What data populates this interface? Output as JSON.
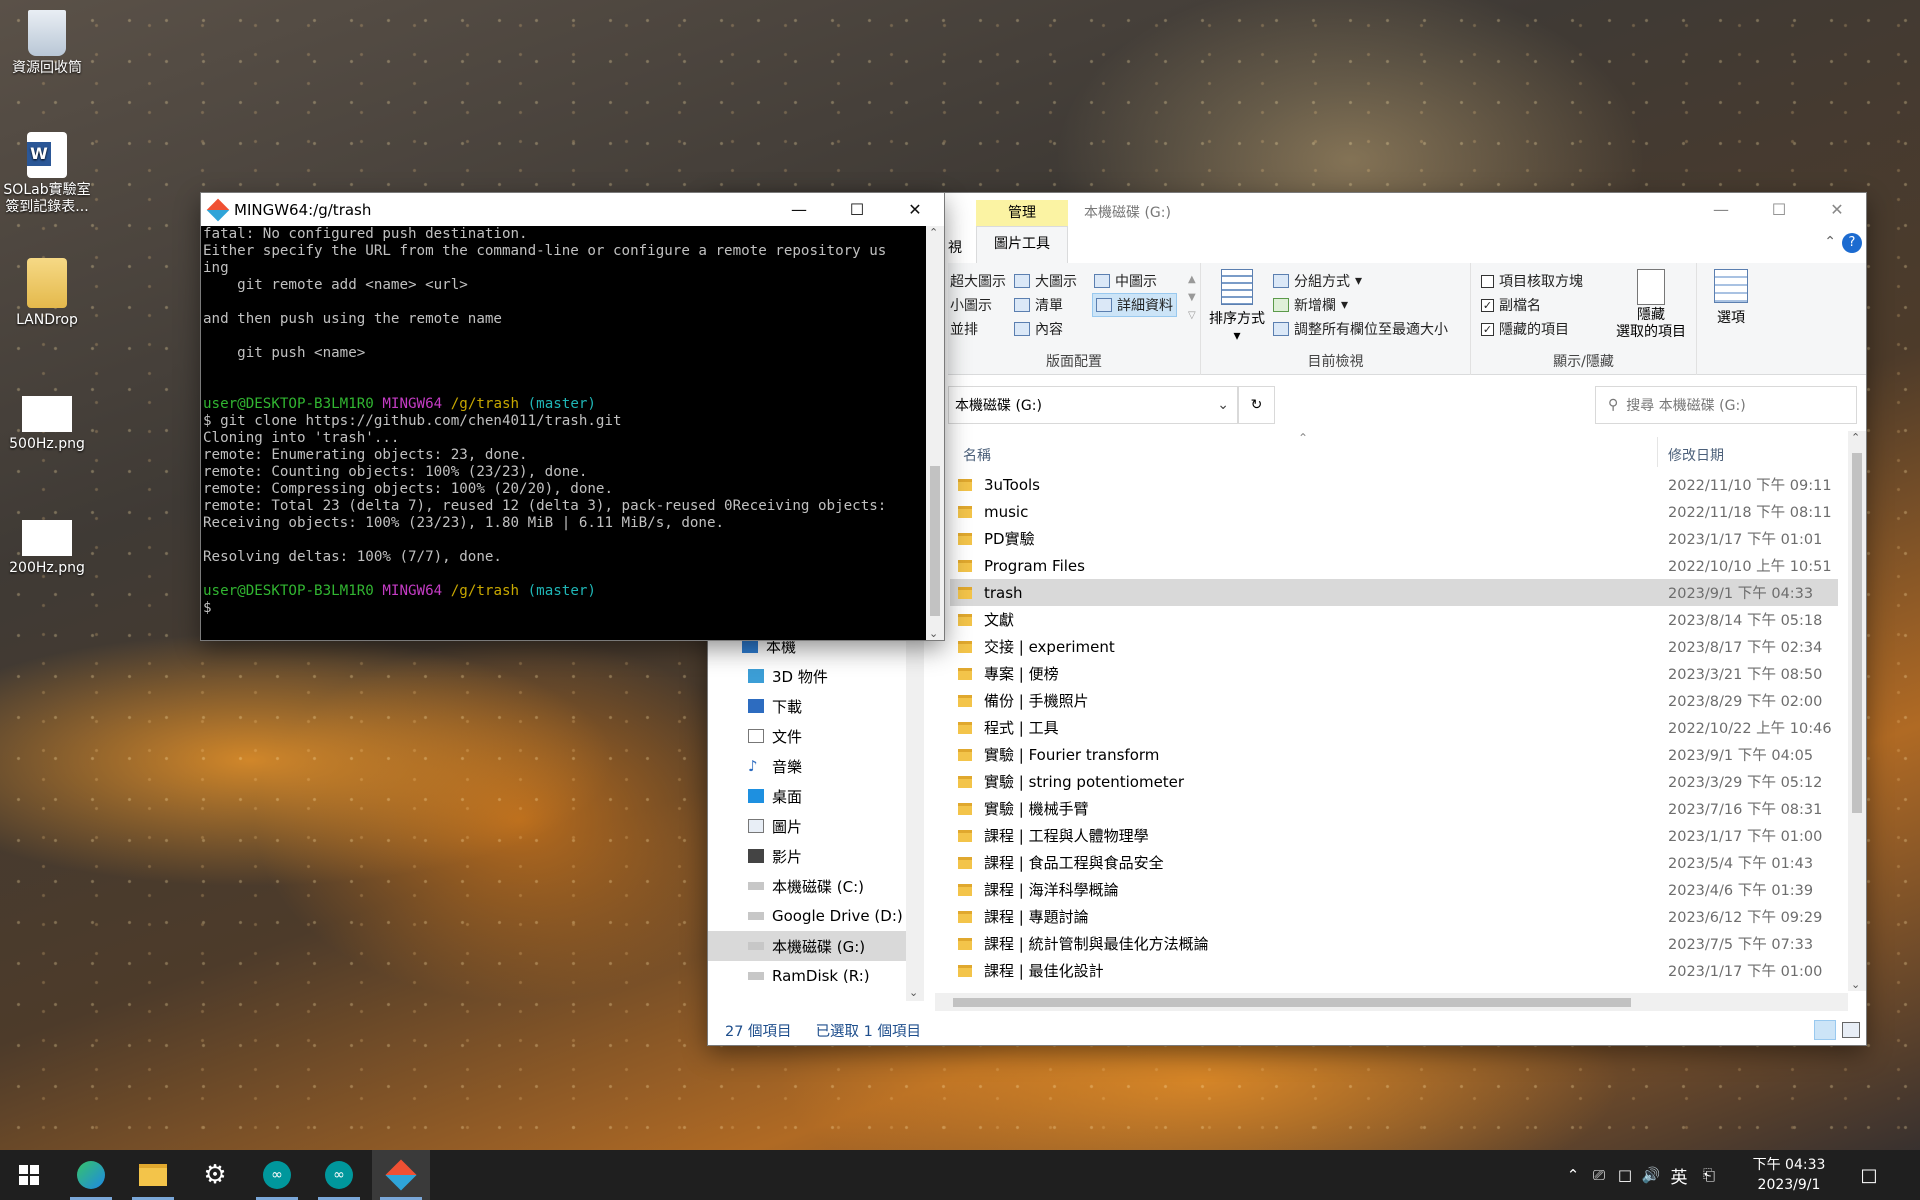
{
  "desktop": {
    "icons": [
      {
        "label": "資源回收筒"
      },
      {
        "label": "SOLab實驗室\n簽到記錄表..."
      },
      {
        "label": "LANDrop"
      },
      {
        "label": "500Hz.png"
      },
      {
        "label": "200Hz.png"
      }
    ]
  },
  "terminal": {
    "title": "MINGW64:/g/trash",
    "lines": [
      "fatal: No configured push destination.",
      "Either specify the URL from the command-line or configure a remote repository us",
      "ing",
      "",
      "    git remote add <name> <url>",
      "",
      "and then push using the remote name",
      "",
      "    git push <name>",
      "",
      ""
    ],
    "prompt1": {
      "user": "user@DESKTOP-B3LM1R0",
      "shell": "MINGW64",
      "path": "/g/trash",
      "branch": "(master)"
    },
    "command": "$ git clone https://github.com/chen4011/trash.git",
    "output": [
      "Cloning into 'trash'...",
      "remote: Enumerating objects: 23, done.",
      "remote: Counting objects: 100% (23/23), done.",
      "remote: Compressing objects: 100% (20/20), done.",
      "remote: Total 23 (delta 7), reused 12 (delta 3), pack-reused 0Receiving objects:",
      "Receiving objects: 100% (23/23), 1.80 MiB | 6.11 MiB/s, done.",
      "",
      "Resolving deltas: 100% (7/7), done.",
      ""
    ],
    "prompt2": {
      "user": "user@DESKTOP-B3LM1R0",
      "shell": "MINGW64",
      "path": "/g/trash",
      "branch": "(master)"
    },
    "cursor_line": "$ "
  },
  "explorer": {
    "title": "本機磁碟 (G:)",
    "context_tab": "管理",
    "tabs": {
      "view_partial": "視",
      "picture_tools": "圖片工具"
    },
    "ribbon": {
      "layout": {
        "items": [
          "超大圖示",
          "大圖示",
          "中圖示",
          "小圖示",
          "清單",
          "詳細資料",
          "並排",
          "內容"
        ],
        "label": "版面配置"
      },
      "current_view": {
        "sort_by": "排序方式",
        "group_by": "分組方式",
        "add_column": "新增欄",
        "fit_columns": "調整所有欄位至最適大小",
        "label": "目前檢視"
      },
      "show_hide": {
        "item_checkboxes": "項目核取方塊",
        "file_extensions": "副檔名",
        "hidden_items": "隱藏的項目",
        "hide_selected": "隱藏\n選取的項目",
        "label": "顯示/隱藏",
        "item_checkboxes_checked": false,
        "file_extensions_checked": true,
        "hidden_items_checked": true
      },
      "options": "選項"
    },
    "address": "本機磁碟 (G:)",
    "search_placeholder": "搜尋 本機磁碟 (G:)",
    "columns": {
      "name": "名稱",
      "date": "修改日期"
    },
    "files": [
      {
        "name": "3uTools",
        "date": "2022/11/10 下午 09:11"
      },
      {
        "name": "music",
        "date": "2022/11/18 下午 08:11"
      },
      {
        "name": "PD實驗",
        "date": "2023/1/17 下午 01:01"
      },
      {
        "name": "Program Files",
        "date": "2022/10/10 上午 10:51"
      },
      {
        "name": "trash",
        "date": "2023/9/1 下午 04:33",
        "selected": true
      },
      {
        "name": "文獻",
        "date": "2023/8/14 下午 05:18"
      },
      {
        "name": "交接 | experiment",
        "date": "2023/8/17 下午 02:34"
      },
      {
        "name": "專案 | 便榜",
        "date": "2023/3/21 下午 08:50"
      },
      {
        "name": "備份 | 手機照片",
        "date": "2023/8/29 下午 02:00"
      },
      {
        "name": "程式 | 工具",
        "date": "2022/10/22 上午 10:46"
      },
      {
        "name": "實驗 | Fourier transform",
        "date": "2023/9/1 下午 04:05"
      },
      {
        "name": "實驗 | string potentiometer",
        "date": "2023/3/29 下午 05:12"
      },
      {
        "name": "實驗 | 機械手臂",
        "date": "2023/7/16 下午 08:31"
      },
      {
        "name": "課程 | 工程與人體物理學",
        "date": "2023/1/17 下午 01:00"
      },
      {
        "name": "課程 | 食品工程與食品安全",
        "date": "2023/5/4 下午 01:43"
      },
      {
        "name": "課程 | 海洋科學概論",
        "date": "2023/4/6 下午 01:39"
      },
      {
        "name": "課程 | 專題討論",
        "date": "2023/6/12 下午 09:29"
      },
      {
        "name": "課程 | 統計管制與最佳化方法概論",
        "date": "2023/7/5 下午 07:33"
      },
      {
        "name": "課程 | 最佳化設計",
        "date": "2023/1/17 下午 01:00"
      }
    ],
    "nav": [
      {
        "label": "本機"
      },
      {
        "label": "3D 物件"
      },
      {
        "label": "下載"
      },
      {
        "label": "文件"
      },
      {
        "label": "音樂"
      },
      {
        "label": "桌面"
      },
      {
        "label": "圖片"
      },
      {
        "label": "影片"
      },
      {
        "label": "本機磁碟 (C:)"
      },
      {
        "label": "Google Drive (D:)"
      },
      {
        "label": "本機磁碟 (G:)",
        "selected": true
      },
      {
        "label": "RamDisk (R:)"
      }
    ],
    "status": {
      "count": "27 個項目",
      "selected": "已選取 1 個項目"
    }
  },
  "taskbar": {
    "ime": "英",
    "time": "下午 04:33",
    "date": "2023/9/1"
  },
  "colors": {
    "selection": "#d9d9d9",
    "context_tab": "#fbf3a3",
    "taskbar": "#1f1f1f"
  }
}
